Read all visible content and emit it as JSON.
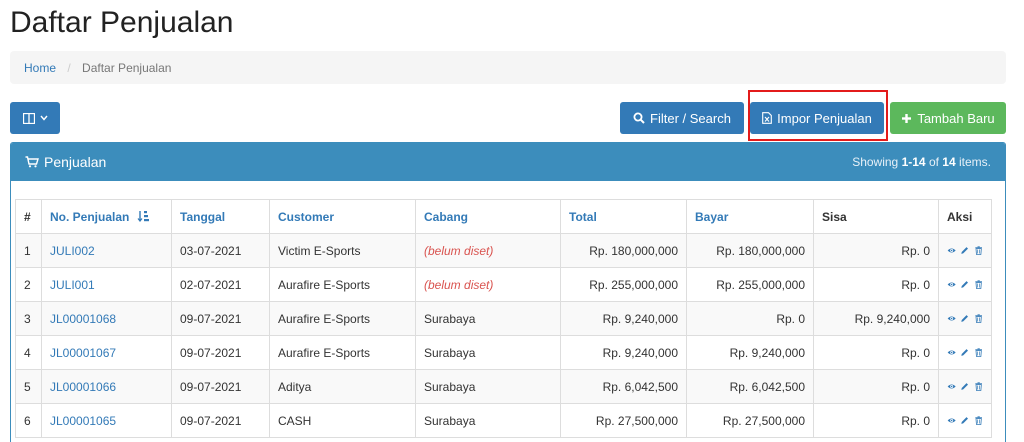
{
  "page": {
    "title": "Daftar Penjualan"
  },
  "breadcrumb": {
    "home": "Home",
    "current": "Daftar Penjualan"
  },
  "toolbar": {
    "columns_icon": "columns-icon",
    "filter_label": "Filter / Search",
    "impor_label": "Impor Penjualan",
    "tambah_label": "Tambah Baru"
  },
  "panel": {
    "title": "Penjualan",
    "summary_prefix": "Showing ",
    "summary_range": "1-14",
    "summary_of": " of ",
    "summary_total": "14",
    "summary_suffix": " items."
  },
  "table": {
    "headers": [
      "#",
      "No. Penjualan",
      "Tanggal",
      "Customer",
      "Cabang",
      "Total",
      "Bayar",
      "Sisa",
      "Aksi"
    ],
    "rows": [
      {
        "no": "1",
        "nomor": "JULI002",
        "tanggal": "03-07-2021",
        "customer": "Victim E-Sports",
        "cabang": "(belum diset)",
        "total": "Rp. 180,000,000",
        "bayar": "Rp. 180,000,000",
        "sisa": "Rp. 0"
      },
      {
        "no": "2",
        "nomor": "JULI001",
        "tanggal": "02-07-2021",
        "customer": "Aurafire E-Sports",
        "cabang": "(belum diset)",
        "total": "Rp. 255,000,000",
        "bayar": "Rp. 255,000,000",
        "sisa": "Rp. 0"
      },
      {
        "no": "3",
        "nomor": "JL00001068",
        "tanggal": "09-07-2021",
        "customer": "Aurafire E-Sports",
        "cabang": "Surabaya",
        "total": "Rp. 9,240,000",
        "bayar": "Rp. 0",
        "sisa": "Rp. 9,240,000"
      },
      {
        "no": "4",
        "nomor": "JL00001067",
        "tanggal": "09-07-2021",
        "customer": "Aurafire E-Sports",
        "cabang": "Surabaya",
        "total": "Rp. 9,240,000",
        "bayar": "Rp. 9,240,000",
        "sisa": "Rp. 0"
      },
      {
        "no": "5",
        "nomor": "JL00001066",
        "tanggal": "09-07-2021",
        "customer": "Aditya",
        "cabang": "Surabaya",
        "total": "Rp. 6,042,500",
        "bayar": "Rp. 6,042,500",
        "sisa": "Rp. 0"
      },
      {
        "no": "6",
        "nomor": "JL00001065",
        "tanggal": "09-07-2021",
        "customer": "CASH",
        "cabang": "Surabaya",
        "total": "Rp. 27,500,000",
        "bayar": "Rp. 27,500,000",
        "sisa": "Rp. 0"
      }
    ]
  },
  "colors": {
    "primary": "#337ab7",
    "success": "#5cb85c",
    "panel": "#3c8dbc",
    "highlight": "#e31b1b",
    "unset": "#d9534f"
  }
}
